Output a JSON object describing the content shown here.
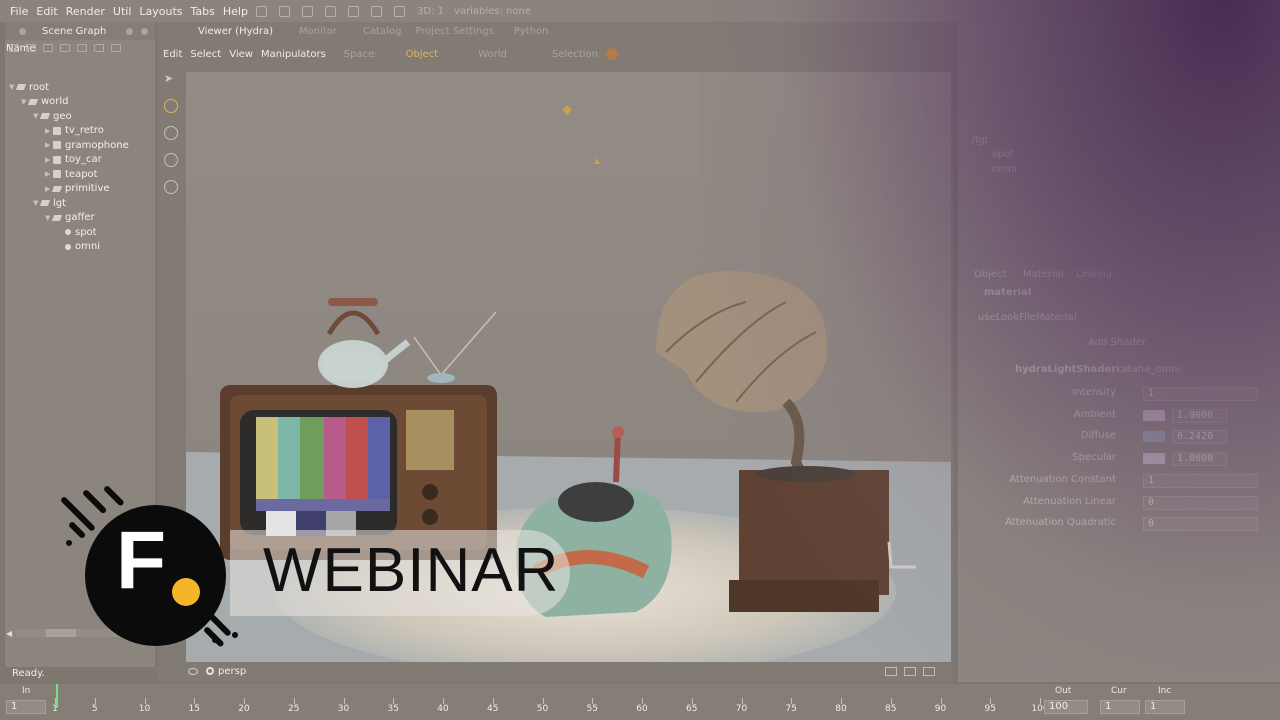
{
  "menubar": {
    "items": [
      "File",
      "Edit",
      "Render",
      "Util",
      "Layouts",
      "Tabs",
      "Help"
    ],
    "toolbar_text_1": "3D: 1",
    "toolbar_text_2": "variables: none"
  },
  "scene_graph": {
    "tab_title": "Scene Graph",
    "column_header": "Name",
    "nodes": [
      {
        "label": "root",
        "depth": 0,
        "kind": "group",
        "expanded": true
      },
      {
        "label": "world",
        "depth": 1,
        "kind": "group",
        "expanded": true
      },
      {
        "label": "geo",
        "depth": 2,
        "kind": "group",
        "expanded": true
      },
      {
        "label": "tv_retro",
        "depth": 3,
        "kind": "geo",
        "expanded": false
      },
      {
        "label": "gramophone",
        "depth": 3,
        "kind": "geo",
        "expanded": false
      },
      {
        "label": "toy_car",
        "depth": 3,
        "kind": "geo",
        "expanded": false
      },
      {
        "label": "teapot",
        "depth": 3,
        "kind": "geo",
        "expanded": false
      },
      {
        "label": "primitive",
        "depth": 3,
        "kind": "group",
        "expanded": false
      },
      {
        "label": "lgt",
        "depth": 2,
        "kind": "group",
        "expanded": true
      },
      {
        "label": "gaffer",
        "depth": 3,
        "kind": "group",
        "expanded": true
      },
      {
        "label": "spot",
        "depth": 4,
        "kind": "light",
        "expanded": false
      },
      {
        "label": "omni",
        "depth": 4,
        "kind": "light",
        "expanded": false
      }
    ]
  },
  "viewer": {
    "tabs": [
      "Viewer (Hydra)",
      "Monitor",
      "Catalog",
      "Project Settings",
      "Python"
    ],
    "menu": [
      "Edit",
      "Select",
      "View",
      "Manipulators"
    ],
    "space_label": "Space:",
    "space_options": [
      "Object",
      "World"
    ],
    "selection_label": "Selection",
    "camera_label": "persp"
  },
  "parameters": {
    "tree_items": [
      "/lgt",
      "spot",
      "omni"
    ],
    "tabs": [
      "Object",
      "Material",
      "Linking"
    ],
    "section": "material",
    "use_look": "useLookFileMaterial",
    "add_shader": "Add Shader",
    "shader_name": "hydraLightShader",
    "shader_type": "katana_omni",
    "params": [
      {
        "label": "Intensity",
        "value": "1",
        "swatch": ""
      },
      {
        "label": "Ambient",
        "value": "1.0000",
        "swatch": "#c8b7c2"
      },
      {
        "label": "Diffuse",
        "value": "0.2420",
        "swatch": "#9aa3b0"
      },
      {
        "label": "Specular",
        "value": "1.0000",
        "swatch": "#c8b9c4"
      },
      {
        "label": "Attenuation Constant",
        "value": "1",
        "swatch": ""
      },
      {
        "label": "Attenuation Linear",
        "value": "0",
        "swatch": ""
      },
      {
        "label": "Attenuation Quadratic",
        "value": "0",
        "swatch": ""
      }
    ]
  },
  "status": "Ready.",
  "timeline": {
    "in_label": "In",
    "in_value": "1",
    "out_label": "Out",
    "out_value": "100",
    "cur_label": "Cur",
    "cur_value": "1",
    "inc_label": "Inc",
    "inc_value": "1",
    "ticks": [
      "1",
      "5",
      "10",
      "15",
      "20",
      "25",
      "30",
      "35",
      "40",
      "45",
      "50",
      "55",
      "60",
      "65",
      "70",
      "75",
      "80",
      "85",
      "90",
      "95",
      "100"
    ]
  },
  "badge": {
    "letter": "F",
    "text": "WEBINAR",
    "accent": "#f5b528"
  },
  "colors": {
    "accent_selected": "#e0b06a",
    "playhead": "#7be07b"
  }
}
